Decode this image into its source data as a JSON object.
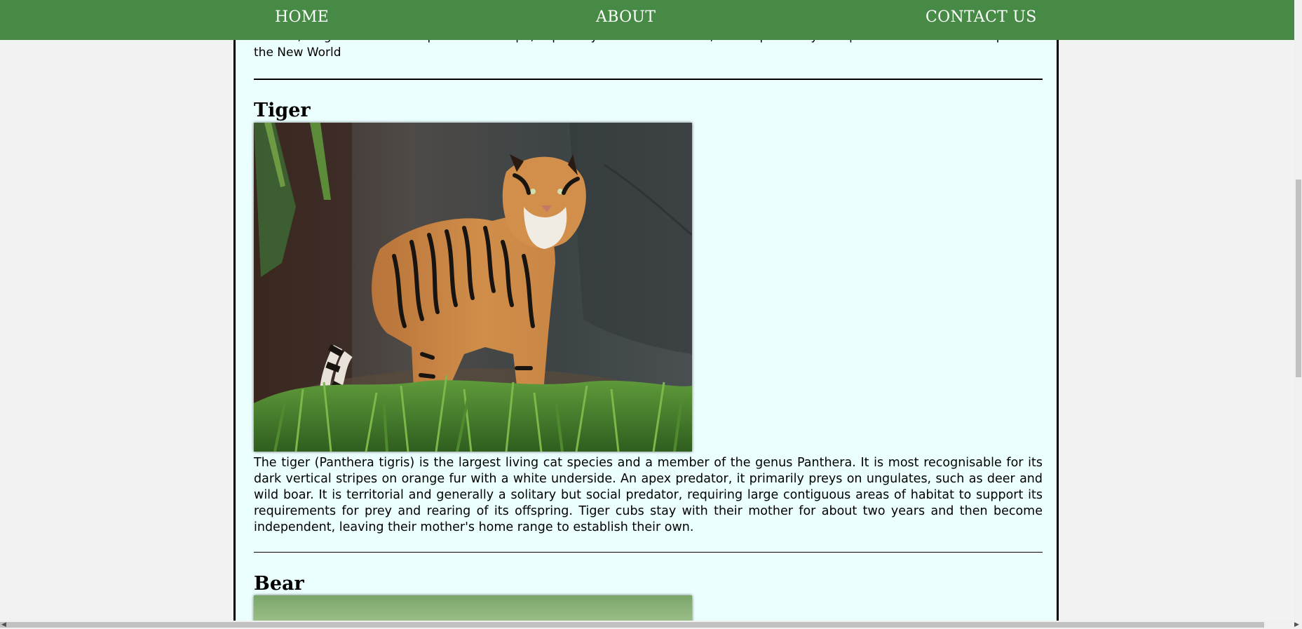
{
  "nav": {
    "home": "HOME",
    "about": "ABOUT",
    "contact": "CONTACT US"
  },
  "prev_section": {
    "text_clipped": "hounds, long an established pursuit in Europe, especially in the British Isles, was exported by European settlers to various parts of the New World"
  },
  "sections": [
    {
      "title": "Tiger",
      "description": "The tiger (Panthera tigris) is the largest living cat species and a member of the genus Panthera. It is most recognisable for its dark vertical stripes on orange fur with a white underside. An apex predator, it primarily preys on ungulates, such as deer and wild boar. It is territorial and generally a solitary but social predator, requiring large contiguous areas of habitat to support its requirements for prey and rearing of its offspring. Tiger cubs stay with their mother for about two years and then become independent, leaving their mother's home range to establish their own."
    },
    {
      "title": "Bear"
    }
  ],
  "colors": {
    "nav_bg": "#468a46",
    "content_bg": "#ecffff",
    "page_bg": "#f2f2f2"
  }
}
